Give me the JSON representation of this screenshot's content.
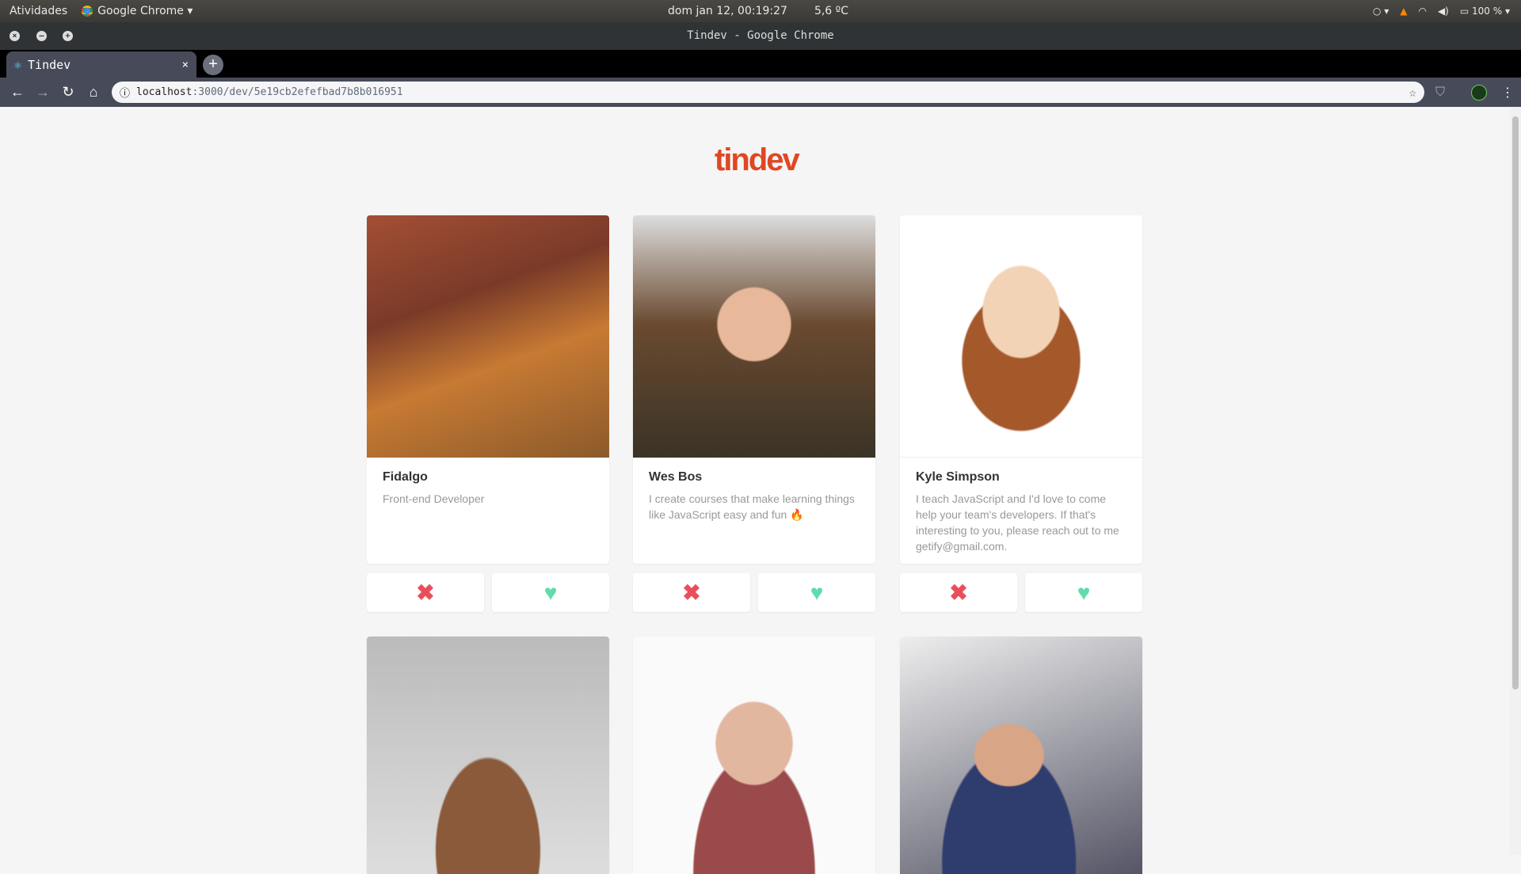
{
  "system": {
    "activities": "Atividades",
    "app": "Google Chrome",
    "clock": "dom jan 12, 00:19:27",
    "weather": "5,6 ºC",
    "battery": "100 %"
  },
  "window": {
    "title": "Tindev - Google Chrome"
  },
  "tab": {
    "label": "Tindev",
    "close": "×",
    "new": "+"
  },
  "address": {
    "host": "localhost",
    "path": ":3000/dev/5e19cb2efefbad7b8b016951"
  },
  "page": {
    "logo": "tindev",
    "dislike_icon": "✖",
    "like_icon": "♥",
    "devs": [
      {
        "name": "Fidalgo",
        "bio": "Front-end Developer"
      },
      {
        "name": "Wes Bos",
        "bio": "I create courses that make learning things like JavaScript easy and fun 🔥"
      },
      {
        "name": "Kyle Simpson",
        "bio": "I teach JavaScript and I'd love to come help your team's developers. If that's interesting to you, please reach out to me getify@gmail.com."
      }
    ]
  },
  "colors": {
    "brand": "#df4723",
    "dislike": "#e94f5a",
    "like": "#5fdcaa"
  }
}
